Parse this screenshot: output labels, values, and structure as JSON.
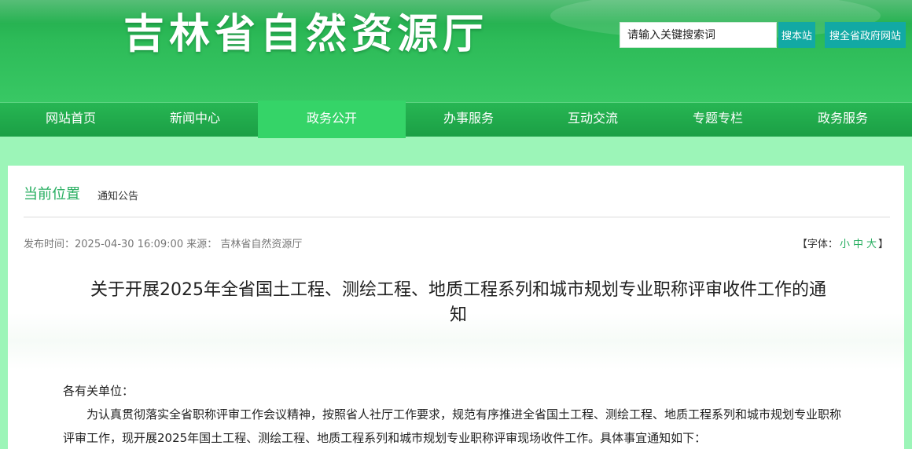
{
  "header": {
    "site_title": "吉林省自然资源厅",
    "search_placeholder": "请输入关键搜索词",
    "search_button": "搜本站",
    "search_all_button": "搜全省政府网站"
  },
  "nav": {
    "items": [
      {
        "label": "网站首页"
      },
      {
        "label": "新闻中心"
      },
      {
        "label": "政务公开",
        "active": true
      },
      {
        "label": "办事服务"
      },
      {
        "label": "互动交流"
      },
      {
        "label": "专题专栏"
      },
      {
        "label": "政务服务"
      }
    ]
  },
  "breadcrumb": {
    "label": "当前位置",
    "current": "通知公告"
  },
  "meta": {
    "publish_label": "发布时间：",
    "publish_time": "2025-04-30 16:09:00",
    "source_label": "来源：",
    "source": "吉林省自然资源厅"
  },
  "font_control": {
    "prefix": "【字体：",
    "small": "小",
    "medium": "中",
    "large": "大",
    "suffix": "】"
  },
  "article": {
    "title": "关于开展2025年全省国土工程、测绘工程、地质工程系列和城市规划专业职称评审收件工作的通知",
    "greeting": "各有关单位：",
    "paragraph": "为认真贯彻落实全省职称评审工作会议精神，按照省人社厅工作要求，规范有序推进全省国土工程、测绘工程、地质工程系列和城市规划专业职称评审工作，现开展2025年国土工程、测绘工程、地质工程系列和城市规划专业职称评审现场收件工作。具体事宜通知如下："
  },
  "colors": {
    "header_green": "#2dbb58",
    "nav_green": "#1b9f45",
    "nav_active": "#35d468",
    "search_button": "#12a9a4",
    "page_bg": "#9cf5b8",
    "accent_text": "#27ae60"
  }
}
